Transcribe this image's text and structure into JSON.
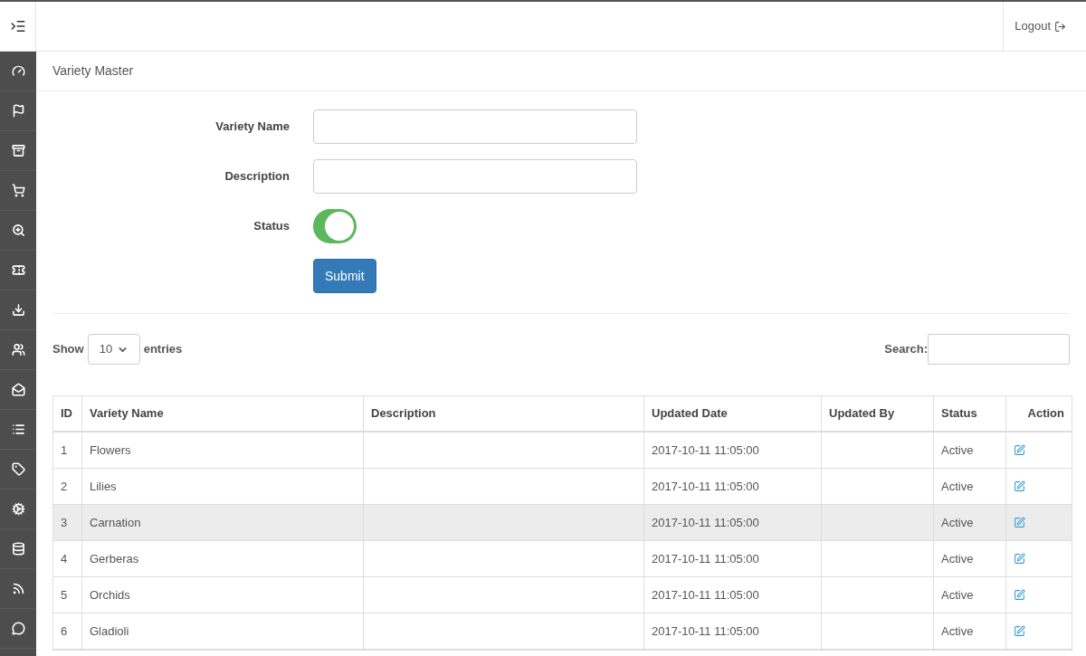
{
  "header": {
    "logout": "Logout"
  },
  "page_title": "Variety Master",
  "form": {
    "fields": [
      {
        "label": "Variety Name",
        "kind": "text"
      },
      {
        "label": "Description",
        "kind": "text"
      },
      {
        "label": "Status",
        "kind": "toggle",
        "on": true
      }
    ],
    "submit": "Submit"
  },
  "table_controls": {
    "show": "Show",
    "page_size": "10",
    "entries": "entries",
    "search_label": "Search:"
  },
  "table": {
    "columns": [
      "ID",
      "Variety Name",
      "Description",
      "Updated Date",
      "Updated By",
      "Status",
      "Action"
    ],
    "rows": [
      {
        "id": "1",
        "name": "Flowers",
        "description": "",
        "updated_date": "2017-10-11 11:05:00",
        "updated_by": "",
        "status": "Active",
        "highlighted": false
      },
      {
        "id": "2",
        "name": "Lilies",
        "description": "",
        "updated_date": "2017-10-11 11:05:00",
        "updated_by": "",
        "status": "Active",
        "highlighted": false
      },
      {
        "id": "3",
        "name": "Carnation",
        "description": "",
        "updated_date": "2017-10-11 11:05:00",
        "updated_by": "",
        "status": "Active",
        "highlighted": true
      },
      {
        "id": "4",
        "name": "Gerberas",
        "description": "",
        "updated_date": "2017-10-11 11:05:00",
        "updated_by": "",
        "status": "Active",
        "highlighted": false
      },
      {
        "id": "5",
        "name": "Orchids",
        "description": "",
        "updated_date": "2017-10-11 11:05:00",
        "updated_by": "",
        "status": "Active",
        "highlighted": false
      },
      {
        "id": "6",
        "name": "Gladioli",
        "description": "",
        "updated_date": "2017-10-11 11:05:00",
        "updated_by": "",
        "status": "Active",
        "highlighted": false
      }
    ]
  }
}
